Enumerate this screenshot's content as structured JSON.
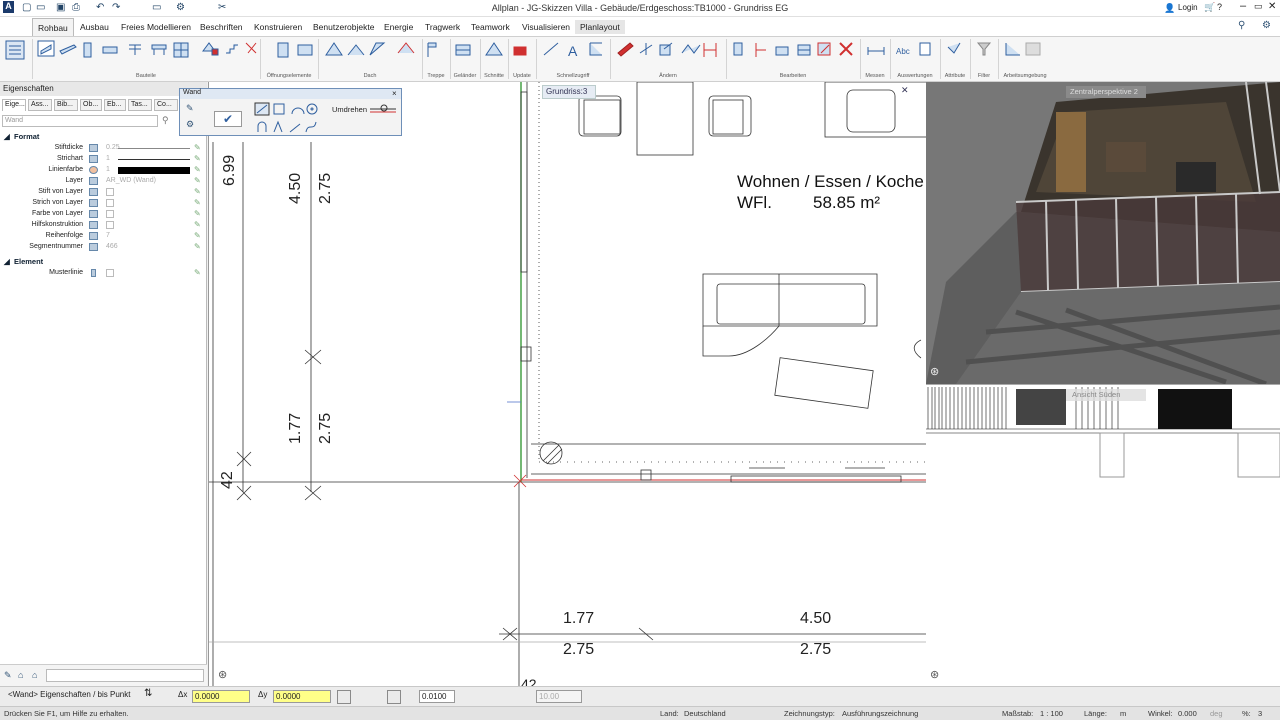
{
  "titlebar": {
    "title": "Allplan - JG-Skizzen Villa - Gebäude/Erdgeschoss:TB1000 - Grundriss EG",
    "login": "Login"
  },
  "tabs": [
    "Rohbau",
    "Ausbau",
    "Freies Modellieren",
    "Beschriften",
    "Konstruieren",
    "Benutzerobjekte",
    "Energie",
    "Tragwerk",
    "Teamwork",
    "Visualisieren",
    "Planlayout"
  ],
  "ribbon_groups": [
    "Bauteile",
    "Öffnungselemente",
    "Dach",
    "Treppe",
    "Geländer",
    "Schnitte",
    "Update",
    "Schnellzugriff",
    "Ändern",
    "Bearbeiten",
    "Messen",
    "Auswertungen",
    "Attribute",
    "Filter",
    "Arbeitsumgebung"
  ],
  "properties": {
    "header": "Eigenschaften",
    "tabs": [
      "Eige...",
      "Ass...",
      "Bib...",
      "Ob...",
      "Eb...",
      "Tas...",
      "Co..."
    ],
    "search_placeholder": "Wand",
    "section_format": "Format",
    "rows": [
      {
        "label": "Stiftdicke",
        "value": "0.25"
      },
      {
        "label": "Strichart",
        "value": "1"
      },
      {
        "label": "Linienfarbe",
        "value": "1"
      },
      {
        "label": "Layer",
        "value": "AR_WD (Wand)"
      },
      {
        "label": "Stift von Layer",
        "value": ""
      },
      {
        "label": "Strich von Layer",
        "value": ""
      },
      {
        "label": "Farbe von Layer",
        "value": ""
      },
      {
        "label": "Hilfskonstruktion",
        "value": ""
      },
      {
        "label": "Reihenfolge",
        "value": "7"
      },
      {
        "label": "Segmentnummer",
        "value": "466"
      }
    ],
    "section_element": "Element",
    "row_muster": {
      "label": "Musterlinie",
      "value": ""
    }
  },
  "wand_palette": {
    "title": "Wand",
    "umdrehen": "Umdrehen"
  },
  "canvas": {
    "view_label": "Grundriss:3",
    "room_name": "Wohnen / Essen / Koche",
    "room_area_label": "WFl.",
    "room_area_value": "58.85 m²",
    "dims": {
      "v1": "6.99",
      "v2": "4.50",
      "v3": "2.75",
      "v4": "1.77",
      "v5": "2.75",
      "v6": "42",
      "h1_top": "1.77",
      "h1_bot": "2.75",
      "h2_top": "4.50",
      "h2_bot": "2.75",
      "h3": "42"
    }
  },
  "view3d": {
    "label": "Zentralperspektive 2"
  },
  "section_view": {
    "label": "Ansicht Süden"
  },
  "bottombar": {
    "command": "<Wand> Eigenschaften / bis Punkt",
    "dx_label": "Δx",
    "dx_value": "0.0000",
    "dy_label": "Δy",
    "dy_value": "0.0000",
    "snap_value": "0.0100",
    "angle_value": "10.00"
  },
  "statusbar": {
    "help": "Drücken Sie F1, um Hilfe zu erhalten.",
    "land_label": "Land:",
    "land_value": "Deutschland",
    "ztyp_label": "Zeichnungstyp:",
    "ztyp_value": "Ausführungszeichnung",
    "massstab_label": "Maßstab:",
    "massstab_value": "1 : 100",
    "laenge_label": "Länge:",
    "laenge_value": "m",
    "winkel_label": "Winkel:",
    "winkel_value": "0.000",
    "winkel_unit": "deg",
    "percent_label": "%:",
    "percent_value": "3"
  },
  "colors": {
    "accent": "#2f5f9f",
    "input_bg": "#ffff88",
    "red_axis": "#d03030",
    "green_axis": "#3a9a3a"
  }
}
